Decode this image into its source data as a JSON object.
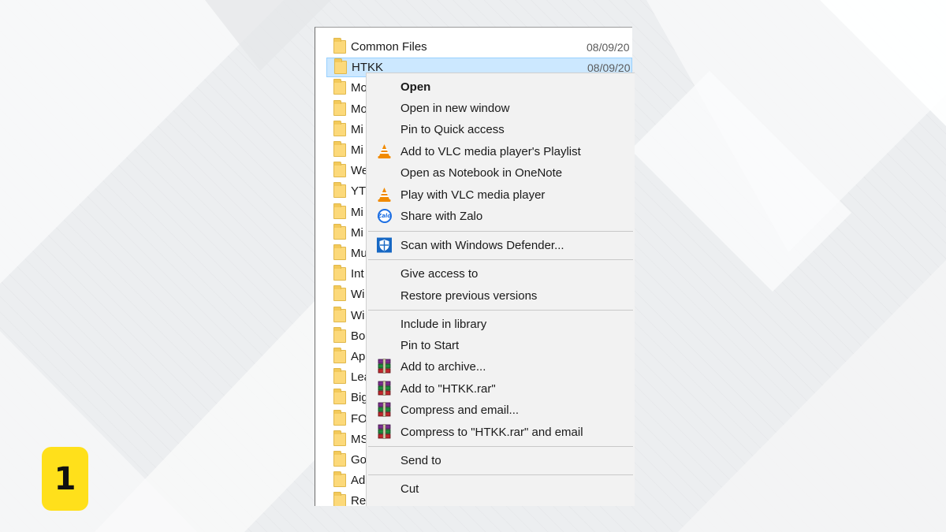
{
  "step": {
    "number": "1"
  },
  "explorer": {
    "files": [
      {
        "name": "Common Files",
        "date": "08/09/20",
        "selected": false
      },
      {
        "name": "HTKK",
        "date": "08/09/20",
        "selected": true
      },
      {
        "name": "Mo",
        "date": "",
        "selected": false
      },
      {
        "name": "Mo",
        "date": "",
        "selected": false
      },
      {
        "name": "Mi",
        "date": "",
        "selected": false
      },
      {
        "name": "Mi",
        "date": "",
        "selected": false
      },
      {
        "name": "We",
        "date": "",
        "selected": false
      },
      {
        "name": "YT",
        "date": "",
        "selected": false
      },
      {
        "name": "Mi",
        "date": "",
        "selected": false
      },
      {
        "name": "Mi",
        "date": "",
        "selected": false
      },
      {
        "name": "Mu",
        "date": "",
        "selected": false
      },
      {
        "name": "Int",
        "date": "",
        "selected": false
      },
      {
        "name": "Wi",
        "date": "",
        "selected": false
      },
      {
        "name": "Wi",
        "date": "",
        "selected": false
      },
      {
        "name": "Bo",
        "date": "",
        "selected": false
      },
      {
        "name": "Ap",
        "date": "",
        "selected": false
      },
      {
        "name": "Lea",
        "date": "",
        "selected": false
      },
      {
        "name": "Big",
        "date": "",
        "selected": false
      },
      {
        "name": "FO",
        "date": "",
        "selected": false
      },
      {
        "name": "MS",
        "date": "",
        "selected": false
      },
      {
        "name": "Go",
        "date": "",
        "selected": false
      },
      {
        "name": "Ad",
        "date": "",
        "selected": false
      },
      {
        "name": "Ref",
        "date": "",
        "selected": false
      }
    ]
  },
  "context_menu": {
    "items": [
      {
        "label": "Open",
        "icon": "",
        "default": true
      },
      {
        "label": "Open in new window",
        "icon": ""
      },
      {
        "label": "Pin to Quick access",
        "icon": ""
      },
      {
        "label": "Add to VLC media player's Playlist",
        "icon": "vlc-icon"
      },
      {
        "label": "Open as Notebook in OneNote",
        "icon": ""
      },
      {
        "label": "Play with VLC media player",
        "icon": "vlc-icon"
      },
      {
        "label": "Share with Zalo",
        "icon": "zalo-icon",
        "icon_text": "Zalo"
      },
      {
        "label": "Scan with Windows Defender...",
        "icon": "windows-defender-icon"
      },
      {
        "label": "Give access to",
        "icon": ""
      },
      {
        "label": "Restore previous versions",
        "icon": ""
      },
      {
        "label": "Include in library",
        "icon": ""
      },
      {
        "label": "Pin to Start",
        "icon": ""
      },
      {
        "label": "Add to archive...",
        "icon": "winrar-icon"
      },
      {
        "label": "Add to \"HTKK.rar\"",
        "icon": "winrar-icon"
      },
      {
        "label": "Compress and email...",
        "icon": "winrar-icon"
      },
      {
        "label": "Compress to \"HTKK.rar\" and email",
        "icon": "winrar-icon"
      },
      {
        "label": "Send to",
        "icon": ""
      },
      {
        "label": "Cut",
        "icon": ""
      }
    ]
  },
  "colors": {
    "selection_bg": "#cce8ff",
    "selection_border": "#99d1ff",
    "menu_bg": "#f2f2f2",
    "badge": "#ffe01b",
    "vlc_orange": "#f18a00",
    "defender_blue": "#1768c4",
    "zalo_blue": "#1d6fe3"
  }
}
